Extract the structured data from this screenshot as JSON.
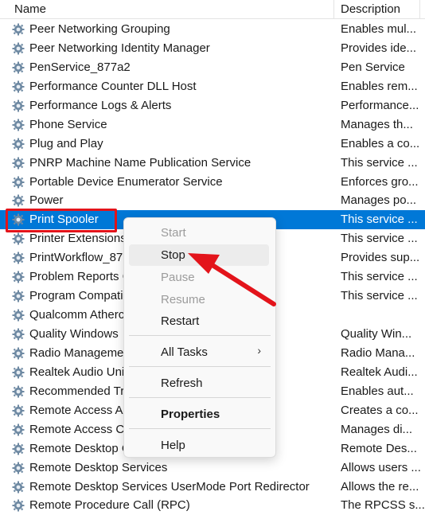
{
  "header": {
    "name_label": "Name",
    "description_label": "Description"
  },
  "services": [
    {
      "name": "Peer Networking Grouping",
      "desc": "Enables mul..."
    },
    {
      "name": "Peer Networking Identity Manager",
      "desc": "Provides ide..."
    },
    {
      "name": "PenService_877a2",
      "desc": "Pen Service"
    },
    {
      "name": "Performance Counter DLL Host",
      "desc": "Enables rem..."
    },
    {
      "name": "Performance Logs & Alerts",
      "desc": "Performance..."
    },
    {
      "name": "Phone Service",
      "desc": "Manages th..."
    },
    {
      "name": "Plug and Play",
      "desc": "Enables a co..."
    },
    {
      "name": "PNRP Machine Name Publication Service",
      "desc": "This service ..."
    },
    {
      "name": "Portable Device Enumerator Service",
      "desc": "Enforces gro..."
    },
    {
      "name": "Power",
      "desc": "Manages po..."
    },
    {
      "name": "Print Spooler",
      "desc": "This service ...",
      "selected": true
    },
    {
      "name": "Printer Extensions",
      "desc": "This service ..."
    },
    {
      "name": "PrintWorkflow_877",
      "desc": "Provides sup..."
    },
    {
      "name": "Problem Reports C",
      "desc": "This service ..."
    },
    {
      "name": "Program Compatib",
      "desc": "This service ..."
    },
    {
      "name": "Qualcomm Atherc",
      "desc": ""
    },
    {
      "name": "Quality Windows",
      "desc": "Quality Win..."
    },
    {
      "name": "Radio Manageme",
      "desc": "Radio Mana..."
    },
    {
      "name": "Realtek Audio Uni",
      "desc": "Realtek Audi..."
    },
    {
      "name": "Recommended Tro",
      "desc": "Enables aut..."
    },
    {
      "name": "Remote Access Au",
      "desc": "Creates a co..."
    },
    {
      "name": "Remote Access Co",
      "desc": "Manages di..."
    },
    {
      "name": "Remote Desktop C",
      "desc": "Remote Des..."
    },
    {
      "name": "Remote Desktop Services",
      "desc": "Allows users ..."
    },
    {
      "name": "Remote Desktop Services UserMode Port Redirector",
      "desc": "Allows the re..."
    },
    {
      "name": "Remote Procedure Call (RPC)",
      "desc": "The RPCSS s..."
    }
  ],
  "context_menu": {
    "start": "Start",
    "stop": "Stop",
    "pause": "Pause",
    "resume": "Resume",
    "restart": "Restart",
    "all_tasks": "All Tasks",
    "all_tasks_chevron": "›",
    "refresh": "Refresh",
    "properties": "Properties",
    "help": "Help"
  },
  "colors": {
    "selection": "#0078d7",
    "annotation": "#e3141b"
  },
  "icons": {
    "service": "gear-icon",
    "submenu": "chevron-right-icon",
    "pointer": "red-arrow-annotation"
  }
}
